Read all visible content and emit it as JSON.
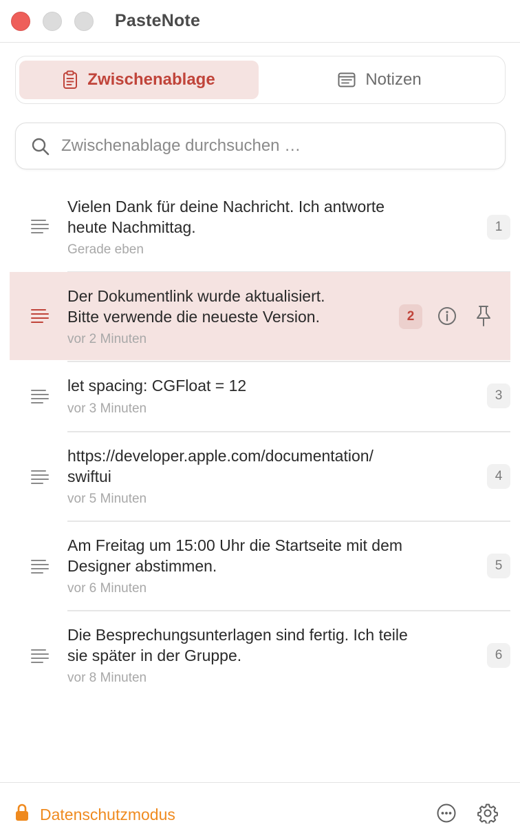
{
  "app": {
    "title": "PasteNote"
  },
  "tabs": [
    {
      "label": "Zwischenablage",
      "icon": "clipboard-icon",
      "active": true
    },
    {
      "label": "Notizen",
      "icon": "notes-icon",
      "active": false
    }
  ],
  "search": {
    "placeholder": "Zwischenablage durchsuchen …",
    "value": ""
  },
  "items": [
    {
      "text": "Vielen Dank für deine Nachricht. Ich antworte\nheute Nachmittag.",
      "time": "Gerade eben",
      "index": "1",
      "selected": false
    },
    {
      "text": "Der Dokumentlink wurde aktualisiert.\nBitte verwende die neueste Version.",
      "time": "vor 2 Minuten",
      "index": "2",
      "selected": true
    },
    {
      "text": "let spacing: CGFloat = 12",
      "time": "vor 3 Minuten",
      "index": "3",
      "selected": false
    },
    {
      "text": "https://developer.apple.com/documentation/\nswiftui",
      "time": "vor 5 Minuten",
      "index": "4",
      "selected": false
    },
    {
      "text": "Am Freitag um 15:00 Uhr die Startseite mit dem\nDesigner abstimmen.",
      "time": "vor 6 Minuten",
      "index": "5",
      "selected": false
    },
    {
      "text": "Die Besprechungsunterlagen sind fertig. Ich teile\nsie später in der Gruppe.",
      "time": "vor 8 Minuten",
      "index": "6",
      "selected": false
    }
  ],
  "footer": {
    "privacy_label": "Datenschutzmodus"
  },
  "colors": {
    "accent": "#c0443a",
    "selected_bg": "#f5e3e1",
    "privacy": "#ef8a1f"
  }
}
